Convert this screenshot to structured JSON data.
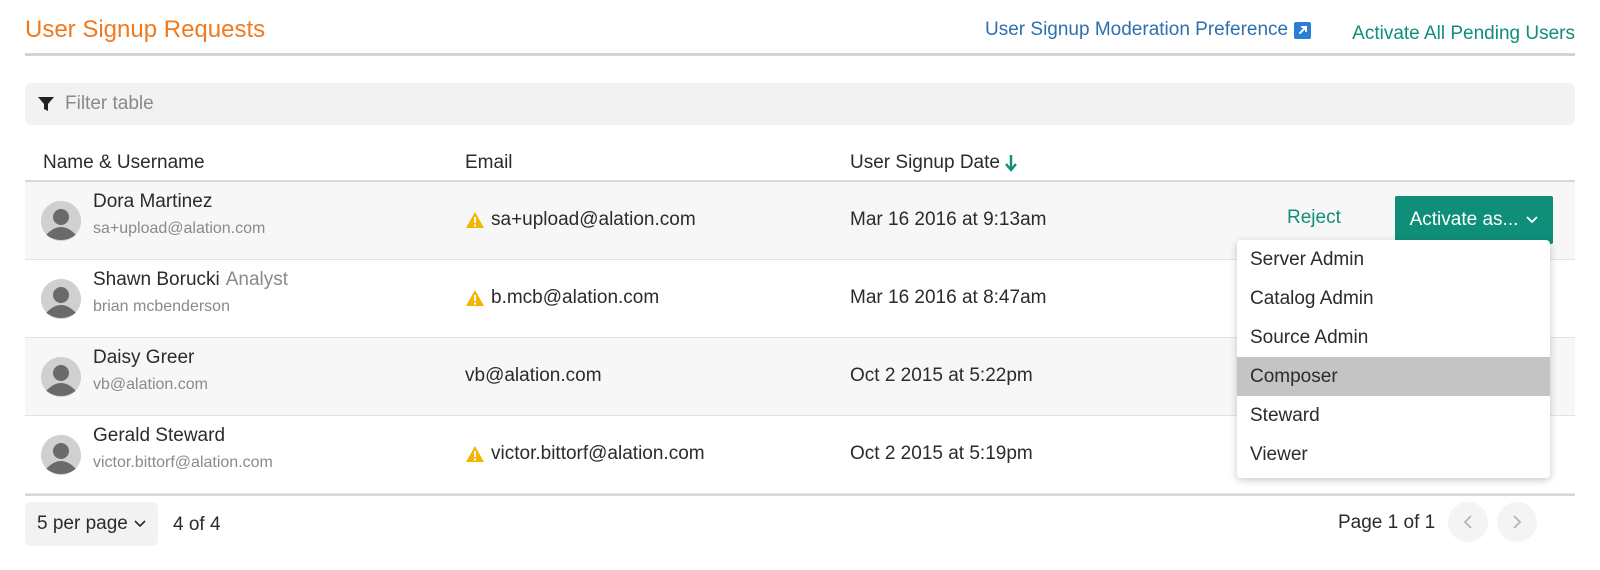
{
  "header": {
    "title": "User Signup Requests",
    "moderation_link": "User Signup Moderation Preference",
    "activate_all_link": "Activate All Pending Users"
  },
  "filter": {
    "placeholder": "Filter table"
  },
  "table": {
    "columns": {
      "name": "Name & Username",
      "email": "Email",
      "date": "User Signup Date"
    },
    "rows": [
      {
        "name": "Dora Martinez",
        "role": "",
        "username": "sa+upload@alation.com",
        "email": "sa+upload@alation.com",
        "email_warning": true,
        "date": "Mar 16 2016 at 9:13am"
      },
      {
        "name": "Shawn Borucki",
        "role": "Analyst",
        "username": "brian mcbenderson",
        "email": "b.mcb@alation.com",
        "email_warning": true,
        "date": "Mar 16 2016 at 8:47am"
      },
      {
        "name": "Daisy Greer",
        "role": "",
        "username": "vb@alation.com",
        "email": "vb@alation.com",
        "email_warning": false,
        "date": "Oct 2 2015 at 5:22pm"
      },
      {
        "name": "Gerald Steward",
        "role": "",
        "username": "victor.bittorf@alation.com",
        "email": "victor.bittorf@alation.com",
        "email_warning": true,
        "date": "Oct 2 2015 at 5:19pm"
      }
    ],
    "row_actions": {
      "reject_label": "Reject",
      "activate_label": "Activate as..."
    }
  },
  "dropdown": {
    "options": [
      "Server Admin",
      "Catalog Admin",
      "Source Admin",
      "Composer",
      "Steward",
      "Viewer"
    ],
    "highlighted": "Composer"
  },
  "footer": {
    "per_page_label": "5 per page",
    "count_text": "4 of 4",
    "page_text": "Page 1 of 1"
  },
  "colors": {
    "title_orange": "#f07a1f",
    "link_blue": "#2d6fb0",
    "accent_teal": "#0f8e7a",
    "warning_yellow": "#f4b400"
  },
  "icons": {
    "external_link": "external-link-icon",
    "filter": "filter-icon",
    "sort_desc": "arrow-down-icon",
    "warning": "warning-icon",
    "chevron": "chevron-down-icon",
    "avatar": "user-avatar-icon",
    "prev": "chevron-left-icon",
    "next": "chevron-right-icon"
  }
}
